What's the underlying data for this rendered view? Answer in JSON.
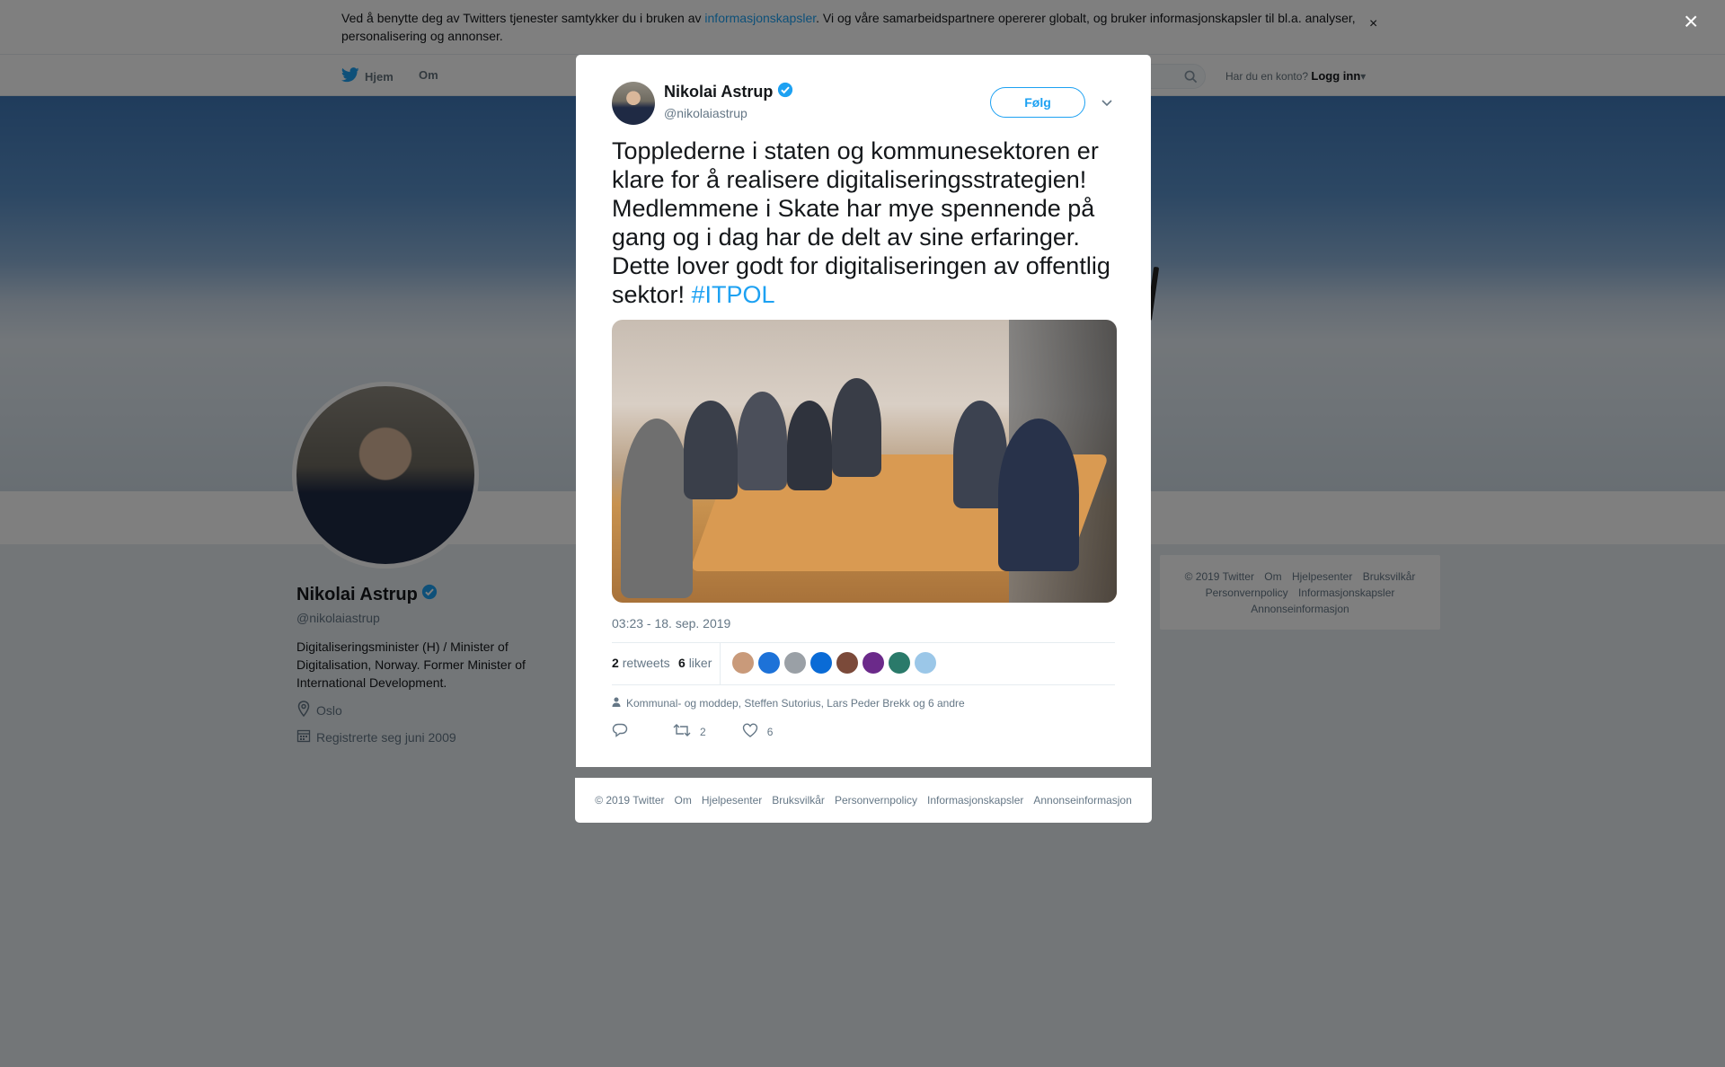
{
  "cookie_bar": {
    "text_before": "Ved å benytte deg av Twitters tjenester samtykker du i bruken av ",
    "link": "informasjonskapsler",
    "text_after": ". Vi og våre samarbeidspartnere opererer globalt, og bruker informasjonskapsler til bl.a. analyser, personalisering og annonser.",
    "close": "×"
  },
  "nav": {
    "home": "Hjem",
    "about": "Om",
    "login_prompt": "Har du en konto?",
    "login": "Logg inn"
  },
  "profile": {
    "name": "Nikolai Astrup",
    "handle": "@nikolaiastrup",
    "bio": "Digitaliseringsminister (H) / Minister of Digitalisation, Norway. Former Minister of International Development.",
    "location": "Oslo",
    "joined": "Registrerte seg juni 2009"
  },
  "side_footer": {
    "items": [
      "© 2019 Twitter",
      "Om",
      "Hjelpesenter",
      "Bruksvilkår",
      "Personvernpolicy",
      "Informasjonskapsler",
      "Annonseinformasjon"
    ]
  },
  "modal": {
    "close": "×",
    "author_name": "Nikolai Astrup",
    "author_handle": "@nikolaiastrup",
    "follow": "Følg",
    "tweet_text": "Topplederne i staten og kommunesektoren er klare for å realisere digitaliseringsstrategien! Medlemmene i Skate har mye spennende på gang og i dag har de delt av sine erfaringer. Dette lover godt for digitaliseringen av offentlig sektor! ",
    "hashtag": "#ITPOL",
    "timestamp": "03:23 - 18. sep. 2019",
    "retweets_count": "2",
    "retweets_label": "retweets",
    "likes_count": "6",
    "likes_label": "liker",
    "liked_by": "Kommunal- og moddep, Steffen Sutorius, Lars Peder Brekk og 6 andre",
    "reply_count": "",
    "retweet_count": "2",
    "like_count": "6",
    "liker_colors": [
      "#c99a7a",
      "#1d72d8",
      "#9aa0a6",
      "#0a6bd6",
      "#7b4a3a",
      "#6b2a8a",
      "#2a7a6a",
      "#9bc7e8"
    ]
  },
  "modal_footer": {
    "items": [
      "© 2019 Twitter",
      "Om",
      "Hjelpesenter",
      "Bruksvilkår",
      "Personvernpolicy",
      "Informasjonskapsler",
      "Annonseinformasjon"
    ]
  },
  "colors": {
    "brand": "#1da1f2",
    "overlay": "rgba(0,0,0,0.5)",
    "muted": "#657786"
  }
}
